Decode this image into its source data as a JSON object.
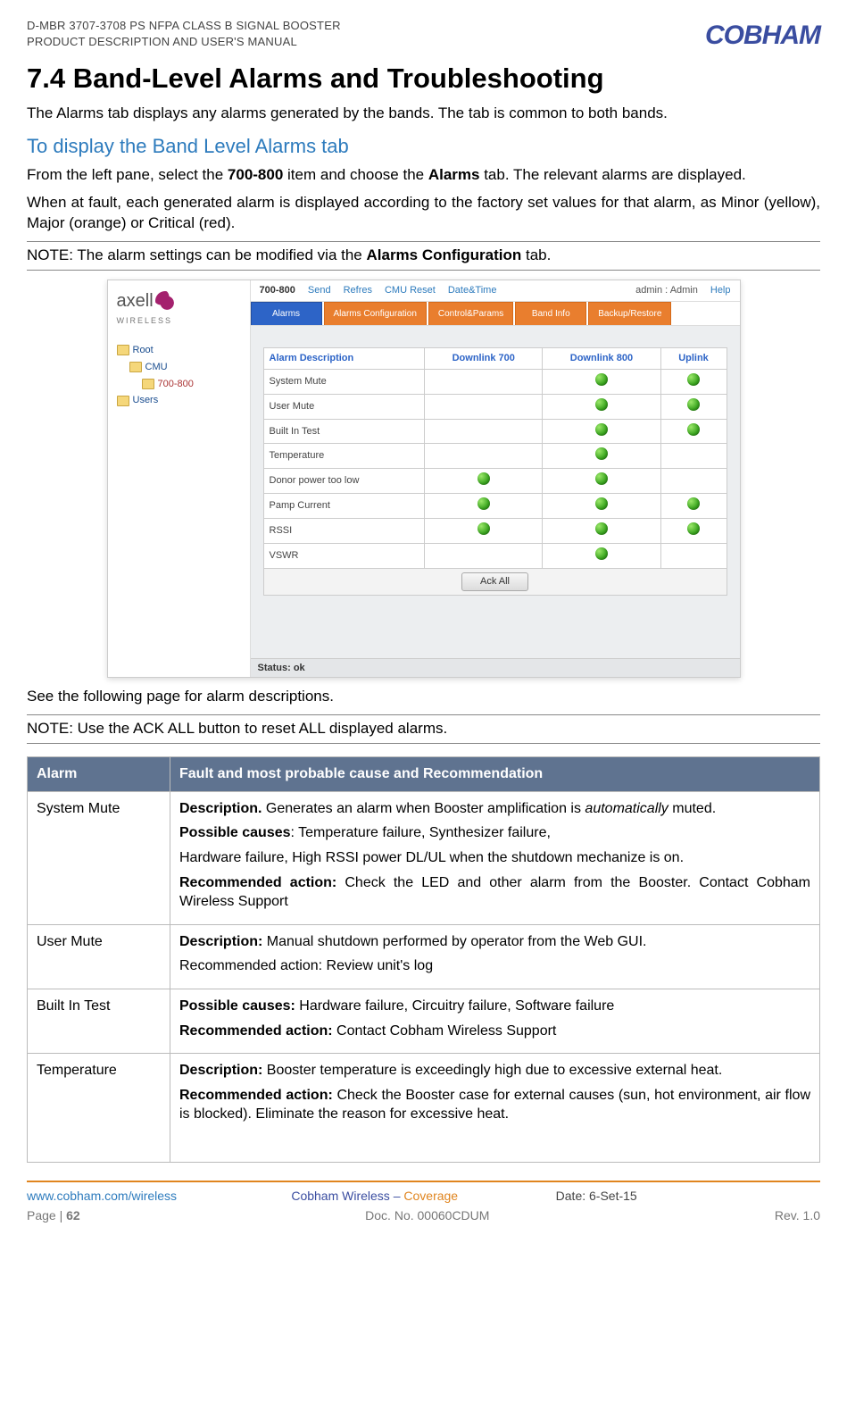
{
  "header": {
    "line1": "D-MBR 3707-3708 PS NFPA CLASS B SIGNAL BOOSTER",
    "line2": "PRODUCT DESCRIPTION AND USER'S MANUAL",
    "logo": "COBHAM"
  },
  "title": "7.4   Band-Level Alarms and Troubleshooting",
  "intro": "The Alarms tab displays any alarms generated by the bands. The tab is common to both bands.",
  "subhead": "To display the Band Level Alarms tab",
  "para1a": "From the left pane, select the ",
  "para1b": "700-800",
  "para1c": " item and choose the ",
  "para1d": "Alarms",
  "para1e": " tab. The relevant alarms are displayed.",
  "para2": "When at fault, each generated alarm is displayed according to the factory set values for that alarm, as Minor (yellow), Major (orange) or Critical (red).",
  "note1a": "NOTE: The alarm settings can be modified via the ",
  "note1b": "Alarms Configuration",
  "note1c": " tab.",
  "screenshot": {
    "brand": "axell",
    "brand_sub": "WIRELESS",
    "tree": {
      "root": "Root",
      "cmu": "CMU",
      "band": "700-800",
      "users": "Users"
    },
    "titlebar": {
      "title": "700-800",
      "send": "Send",
      "refresh": "Refres",
      "cmureset": "CMU Reset",
      "datetime": "Date&Time",
      "admin_label": "admin",
      "admin_value": "Admin",
      "help": "Help"
    },
    "tabs": [
      "Alarms",
      "Alarms Configuration",
      "Control&Params",
      "Band Info",
      "Backup/Restore"
    ],
    "columns": [
      "Alarm Description",
      "Downlink 700",
      "Downlink 800",
      "Uplink"
    ],
    "rows": [
      {
        "name": "System Mute",
        "d700": false,
        "d800": true,
        "ul": true
      },
      {
        "name": "User Mute",
        "d700": false,
        "d800": true,
        "ul": true
      },
      {
        "name": "Built In Test",
        "d700": false,
        "d800": true,
        "ul": true
      },
      {
        "name": "Temperature",
        "d700": false,
        "d800": true,
        "ul": false
      },
      {
        "name": "Donor power too low",
        "d700": true,
        "d800": true,
        "ul": false
      },
      {
        "name": "Pamp Current",
        "d700": true,
        "d800": true,
        "ul": true
      },
      {
        "name": "RSSI",
        "d700": true,
        "d800": true,
        "ul": true
      },
      {
        "name": "VSWR",
        "d700": false,
        "d800": true,
        "ul": false
      }
    ],
    "ack": "Ack All",
    "status": "Status: ok"
  },
  "afterimg": "See the following page for alarm descriptions.",
  "note2": "NOTE: Use the ACK ALL button to reset ALL displayed alarms.",
  "table": {
    "h1": "Alarm",
    "h2": "Fault and most probable cause and Recommendation",
    "rows": {
      "r1": {
        "name": "System Mute",
        "p1a": "Description.",
        "p1b": " Generates an alarm when Booster amplification is ",
        "p1c": "automatically",
        "p1d": " muted.",
        "p2a": "Possible causes",
        "p2b": ": Temperature failure, Synthesizer failure,",
        "p3": "Hardware failure, High RSSI power DL/UL when the shutdown mechanize is on.",
        "p4a": "Recommended action:",
        "p4b": " Check the LED and other alarm from the Booster. Contact Cobham Wireless Support"
      },
      "r2": {
        "name": "User Mute",
        "p1a": "Description:",
        "p1b": " Manual shutdown performed by operator from the Web GUI.",
        "p2": "Recommended action: Review unit's log"
      },
      "r3": {
        "name": "Built In Test",
        "p1a": "Possible causes:",
        "p1b": " Hardware failure, Circuitry failure, Software failure",
        "p2a": "Recommended action:",
        "p2b": " Contact Cobham Wireless Support"
      },
      "r4": {
        "name": "Temperature",
        "p1a": "Description:",
        "p1b": " Booster temperature is exceedingly high due to excessive external heat.",
        "p2a": "Recommended action:",
        "p2b": " Check the Booster case for external causes (sun, hot environment, air flow is blocked). Eliminate the reason for excessive heat."
      }
    }
  },
  "footer": {
    "url": "www.cobham.com/wireless",
    "mid1": "Cobham Wireless",
    "mid_sep": " – ",
    "mid2": "Coverage",
    "date": "Date: 6-Set-15",
    "page_label": "Page | ",
    "page_num": "62",
    "doc": "Doc. No. 00060CDUM",
    "rev": "Rev. 1.0"
  }
}
